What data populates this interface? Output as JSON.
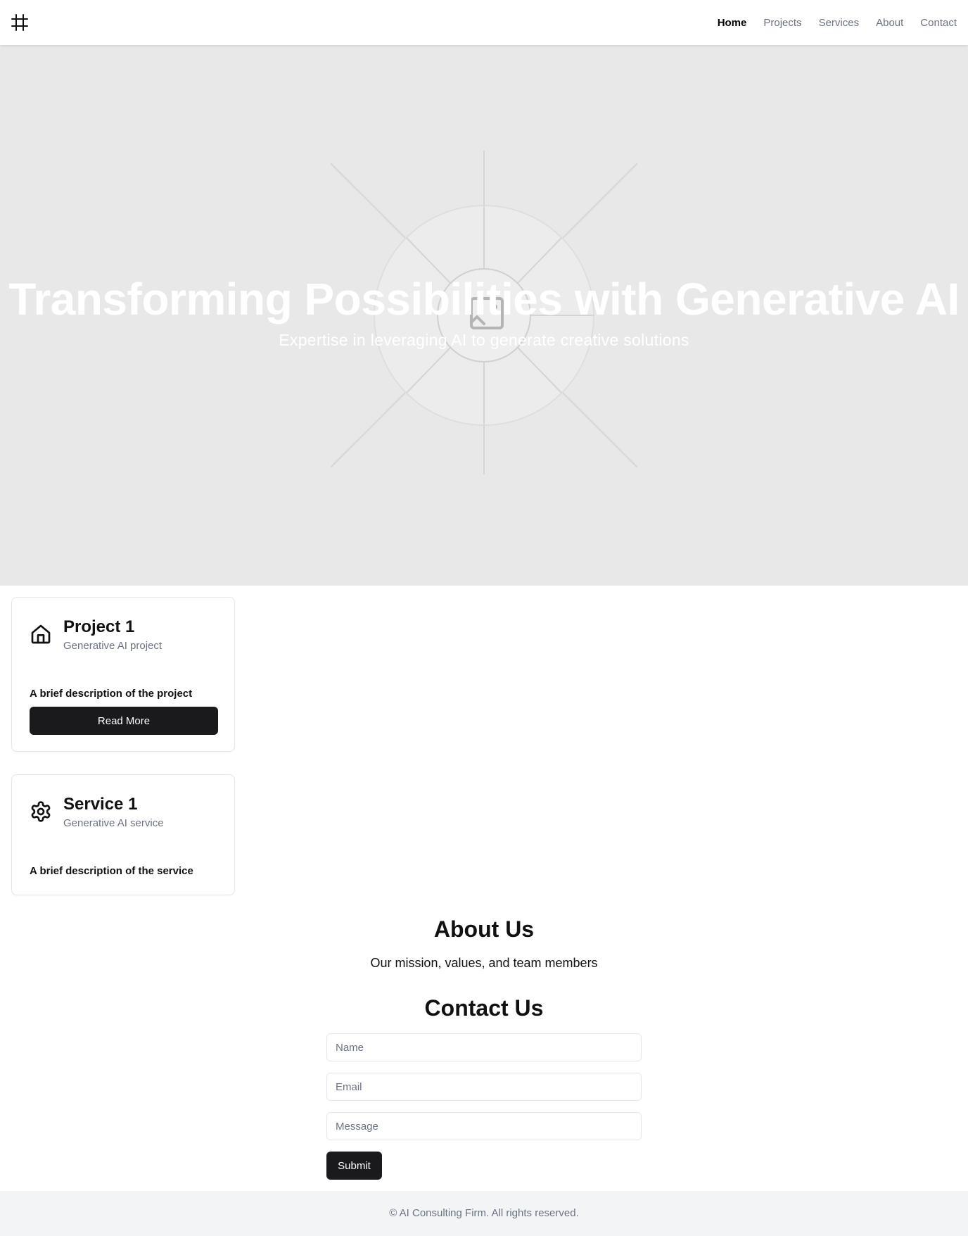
{
  "header": {
    "logo_icon": "hash-grid-icon",
    "nav": [
      {
        "label": "Home",
        "active": true
      },
      {
        "label": "Projects",
        "active": false
      },
      {
        "label": "Services",
        "active": false
      },
      {
        "label": "About",
        "active": false
      },
      {
        "label": "Contact",
        "active": false
      }
    ]
  },
  "hero": {
    "title": "Transforming Possibilities with Generative AI",
    "subtitle": "Expertise in leveraging AI to generate creative solutions",
    "background_icon": "image-placeholder-icon"
  },
  "project_card": {
    "icon": "home-icon",
    "title": "Project 1",
    "subtitle": "Generative AI project",
    "description": "A brief description of the project",
    "button_label": "Read More"
  },
  "service_card": {
    "icon": "gear-icon",
    "title": "Service 1",
    "subtitle": "Generative AI service",
    "description": "A brief description of the service"
  },
  "about": {
    "title": "About Us",
    "text": "Our mission, values, and team members"
  },
  "contact": {
    "title": "Contact Us",
    "name_placeholder": "Name",
    "email_placeholder": "Email",
    "message_placeholder": "Message",
    "submit_label": "Submit"
  },
  "footer": {
    "text": "© AI Consulting Firm. All rights reserved."
  },
  "colors": {
    "hero_bg": "#e8e8e8",
    "button_dark": "#1a1a1c",
    "muted_text": "#6b7280",
    "footer_bg": "#f3f4f6"
  }
}
